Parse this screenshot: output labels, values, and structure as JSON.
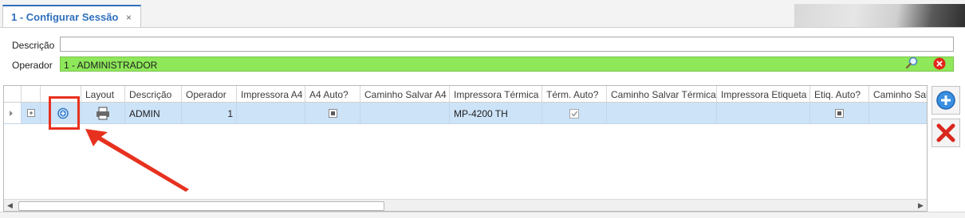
{
  "tab": {
    "title": "1 - Configurar Sessão",
    "close": "×"
  },
  "form": {
    "descricao_label": "Descrição",
    "descricao_value": "",
    "operador_label": "Operador",
    "operador_value": "1 - ADMINISTRADOR"
  },
  "grid": {
    "columns": [
      "Layout",
      "Descrição",
      "Operador",
      "Impressora A4",
      "A4 Auto?",
      "Caminho Salvar A4",
      "Impressora Térmica",
      "Térm. Auto?",
      "Caminho Salvar Térmica",
      "Impressora Etiqueta",
      "Etiq. Auto?",
      "Caminho Salvar"
    ],
    "row": {
      "descricao": "ADMIN",
      "operador": "1",
      "impressora_a4": "",
      "caminho_a4": "",
      "impressora_termica": "MP-4200 TH",
      "caminho_termica": "",
      "impressora_etiqueta": "",
      "caminho_salvar": ""
    }
  },
  "icons": {
    "expand": "plus-box-icon",
    "add_row": "plus-circle-icon",
    "layout": "printer-icon",
    "search": "magnifier-icon",
    "clear": "clear-red-icon",
    "side_add": "plus-circle-icon",
    "side_delete": "red-x-icon"
  },
  "colors": {
    "accent": "#2e6fbd",
    "operator_bg": "#8ee85a",
    "row_selected": "#cde3f7",
    "annotation": "#e7311f"
  }
}
